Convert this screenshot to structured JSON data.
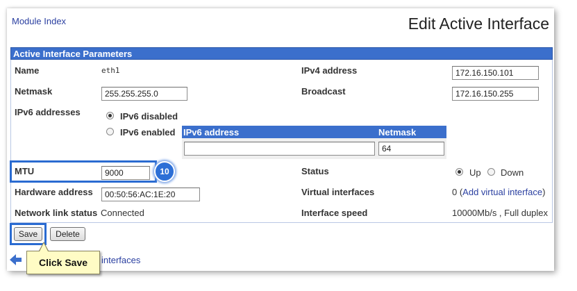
{
  "header": {
    "module_index": "Module Index",
    "title": "Edit Active Interface"
  },
  "section": {
    "title": "Active Interface Parameters"
  },
  "fields": {
    "name_label": "Name",
    "name_value": "eth1",
    "ipv4_label": "IPv4 address",
    "ipv4_value": "172.16.150.101",
    "netmask_label": "Netmask",
    "netmask_value": "255.255.255.0",
    "broadcast_label": "Broadcast",
    "broadcast_value": "172.16.150.255",
    "ipv6_label": "IPv6 addresses",
    "ipv6_disabled": "IPv6 disabled",
    "ipv6_enabled": "IPv6 enabled",
    "ipv6_selected": "disabled",
    "ipv6_col_address": "IPv6 address",
    "ipv6_col_netmask": "Netmask",
    "ipv6_address_value": "",
    "ipv6_netmask_value": "64",
    "mtu_label": "MTU",
    "mtu_value": "9000",
    "status_label": "Status",
    "status_up": "Up",
    "status_down": "Down",
    "status_selected": "up",
    "hwaddr_label": "Hardware address",
    "hwaddr_value": "00:50:56:AC:1E:20",
    "virtual_label": "Virtual interfaces",
    "virtual_count": "0 (",
    "virtual_link": "Add virtual interface",
    "virtual_close": ")",
    "linkstatus_label": "Network link status",
    "linkstatus_value": "Connected",
    "speed_label": "Interface speed",
    "speed_value": "10000Mb/s , Full duplex"
  },
  "buttons": {
    "save": "Save",
    "delete": "Delete"
  },
  "annotation": {
    "step_number": "10",
    "callout": "Click Save"
  },
  "footer": {
    "return_link": "interfaces",
    "back_icon": "arrow-left-icon"
  },
  "colors": {
    "accent": "#3b6fcc",
    "highlight": "#2a6bd1",
    "link": "#2a3fa0",
    "callout_bg": "#fffcc5"
  }
}
